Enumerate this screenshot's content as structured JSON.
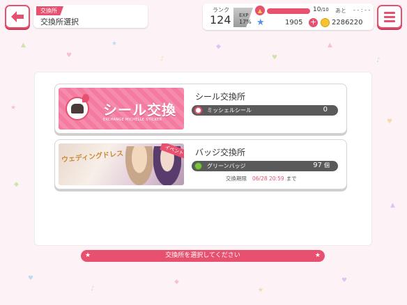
{
  "header": {
    "title_tag": "交換所",
    "title": "交換所選択"
  },
  "status": {
    "rank_label": "ランク",
    "rank": "124",
    "exp_label": "EXP",
    "exp_percent": "17%",
    "exp_fraction": 0.17,
    "live_count": "10",
    "live_max": "/10",
    "live_fraction": 1.0,
    "ato_label": "あと",
    "timer": "- - : - -",
    "stars": "1905",
    "coins": "2286220"
  },
  "shops": [
    {
      "banner_title": "シール交換",
      "banner_subtitle": "EXCHANGE MICHELLE STICKER",
      "name": "シール交換所",
      "item_name": "ミッシェルシール",
      "item_count": "0",
      "item_unit": ""
    },
    {
      "banner_deco": "ウェディングドレス",
      "banner_tag": "イベント",
      "name": "バッジ交換所",
      "item_name": "グリーンバッジ",
      "item_count": "97",
      "item_unit": "個",
      "period_label": "交換期限",
      "period_date": "06/28 20:59",
      "period_suffix": "まで"
    }
  ],
  "footer": {
    "instruction": "交換所を選択してください"
  },
  "colors": {
    "accent": "#e8506f",
    "background": "#fdf3f6"
  },
  "icons": {
    "back": "arrow-left-icon",
    "menu": "hamburger-menu-icon",
    "live": "flame-icon",
    "star": "star-icon",
    "coin": "coin-icon"
  }
}
